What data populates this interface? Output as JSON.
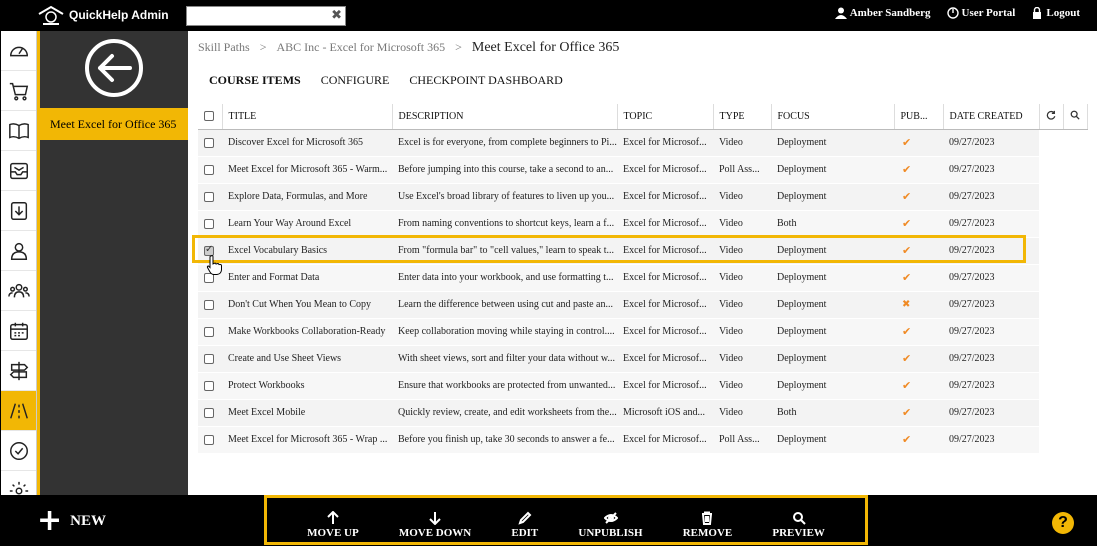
{
  "app": {
    "title": "QuickHelp Admin"
  },
  "topbar": {
    "user_name": "Amber Sandberg",
    "user_portal": "User Portal",
    "logout": "Logout",
    "search_value": ""
  },
  "sidebar": {
    "active_item": "Meet Excel for Office 365"
  },
  "breadcrumb": {
    "items": [
      "Skill Paths",
      "ABC Inc - Excel for Microsoft 365"
    ],
    "separator": ">",
    "current": "Meet Excel for Office 365"
  },
  "tabs": [
    "COURSE ITEMS",
    "CONFIGURE",
    "CHECKPOINT DASHBOARD"
  ],
  "table": {
    "headers": {
      "title": "TITLE",
      "description": "DESCRIPTION",
      "topic": "TOPIC",
      "type": "TYPE",
      "focus": "FOCUS",
      "published": "PUB...",
      "date": "DATE CREATED"
    },
    "rows": [
      {
        "title": "Discover Excel for Microsoft 365",
        "description": "Excel is for everyone, from complete beginners to Pi...",
        "topic": "Excel for Microsof...",
        "type": "Video",
        "focus": "Deployment",
        "published": true,
        "date": "09/27/2023",
        "checked": false
      },
      {
        "title": "Meet Excel for Microsoft 365 - Warm...",
        "description": "Before jumping into this course, take a second to an...",
        "topic": "Excel for Microsof...",
        "type": "Poll Ass...",
        "focus": "Deployment",
        "published": true,
        "date": "09/27/2023",
        "checked": false
      },
      {
        "title": "Explore Data, Formulas, and More",
        "description": "Use Excel's broad library of features to liven up you...",
        "topic": "Excel for Microsof...",
        "type": "Video",
        "focus": "Deployment",
        "published": true,
        "date": "09/27/2023",
        "checked": false
      },
      {
        "title": "Learn Your Way Around Excel",
        "description": "From naming conventions to shortcut keys, learn a f...",
        "topic": "Excel for Microsof...",
        "type": "Video",
        "focus": "Both",
        "published": true,
        "date": "09/27/2023",
        "checked": false
      },
      {
        "title": "Excel Vocabulary Basics",
        "description": "From \"formula bar\" to \"cell values,\" learn to speak t...",
        "topic": "Excel for Microsof...",
        "type": "Video",
        "focus": "Deployment",
        "published": true,
        "date": "09/27/2023",
        "checked": true
      },
      {
        "title": "Enter and Format Data",
        "description": "Enter data into your workbook, and use formatting t...",
        "topic": "Excel for Microsof...",
        "type": "Video",
        "focus": "Deployment",
        "published": true,
        "date": "09/27/2023",
        "checked": false
      },
      {
        "title": "Don't Cut When You Mean to Copy",
        "description": "Learn the difference between using cut and paste an...",
        "topic": "Excel for Microsof...",
        "type": "Video",
        "focus": "Deployment",
        "published": false,
        "date": "09/27/2023",
        "checked": false
      },
      {
        "title": "Make Workbooks Collaboration-Ready",
        "description": "Keep collaboration moving while staying in control....",
        "topic": "Excel for Microsof...",
        "type": "Video",
        "focus": "Deployment",
        "published": true,
        "date": "09/27/2023",
        "checked": false
      },
      {
        "title": "Create and Use Sheet Views",
        "description": "With sheet views, sort and filter your data without w...",
        "topic": "Excel for Microsof...",
        "type": "Video",
        "focus": "Deployment",
        "published": true,
        "date": "09/27/2023",
        "checked": false
      },
      {
        "title": "Protect Workbooks",
        "description": "Ensure that workbooks are protected from unwanted...",
        "topic": "Excel for Microsof...",
        "type": "Video",
        "focus": "Deployment",
        "published": true,
        "date": "09/27/2023",
        "checked": false
      },
      {
        "title": "Meet Excel Mobile",
        "description": "Quickly review, create, and edit worksheets from the...",
        "topic": "Microsoft iOS and...",
        "type": "Video",
        "focus": "Both",
        "published": true,
        "date": "09/27/2023",
        "checked": false
      },
      {
        "title": "Meet Excel for Microsoft 365 - Wrap ...",
        "description": "Before you finish up, take 30 seconds to answer a fe...",
        "topic": "Excel for Microsof...",
        "type": "Poll Ass...",
        "focus": "Deployment",
        "published": true,
        "date": "09/27/2023",
        "checked": false
      }
    ]
  },
  "bottombar": {
    "new_label": "NEW",
    "actions": [
      "MOVE UP",
      "MOVE DOWN",
      "EDIT",
      "UNPUBLISH",
      "REMOVE",
      "PREVIEW"
    ],
    "help": "?"
  },
  "colors": {
    "accent": "#f2b705",
    "check": "#f08a24",
    "dark": "#000000",
    "sidebar": "#333333"
  },
  "icons": {
    "rail": [
      "dashboard-icon",
      "cart-icon",
      "book-icon",
      "inbox-icon",
      "download-icon",
      "user-icon",
      "users-icon",
      "calendar-icon",
      "signpost-icon",
      "road-icon",
      "checkmark-badge-icon",
      "gear-icon"
    ]
  }
}
